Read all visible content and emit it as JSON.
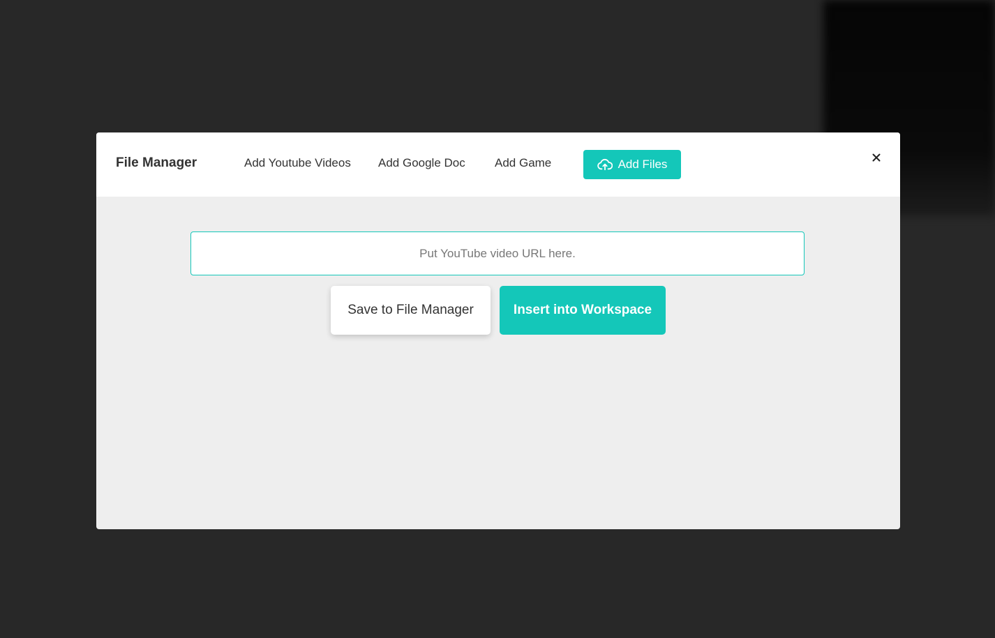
{
  "colors": {
    "accent": "#14c7b9",
    "backdrop": "#282828",
    "header_bg": "#ffffff",
    "body_bg": "#eeeeee",
    "text": "#333333"
  },
  "modal": {
    "title": "File Manager",
    "tabs": [
      {
        "label": "Add Youtube Videos"
      },
      {
        "label": "Add Google Doc"
      },
      {
        "label": "Add Game"
      }
    ],
    "add_files": {
      "label": "Add Files",
      "icon": "cloud-upload-icon"
    },
    "close_icon": "close-icon"
  },
  "youtube_form": {
    "url_input": {
      "value": "",
      "placeholder": "Put YouTube video URL here."
    },
    "save_label": "Save to File Manager",
    "insert_label": "Insert into Workspace"
  }
}
